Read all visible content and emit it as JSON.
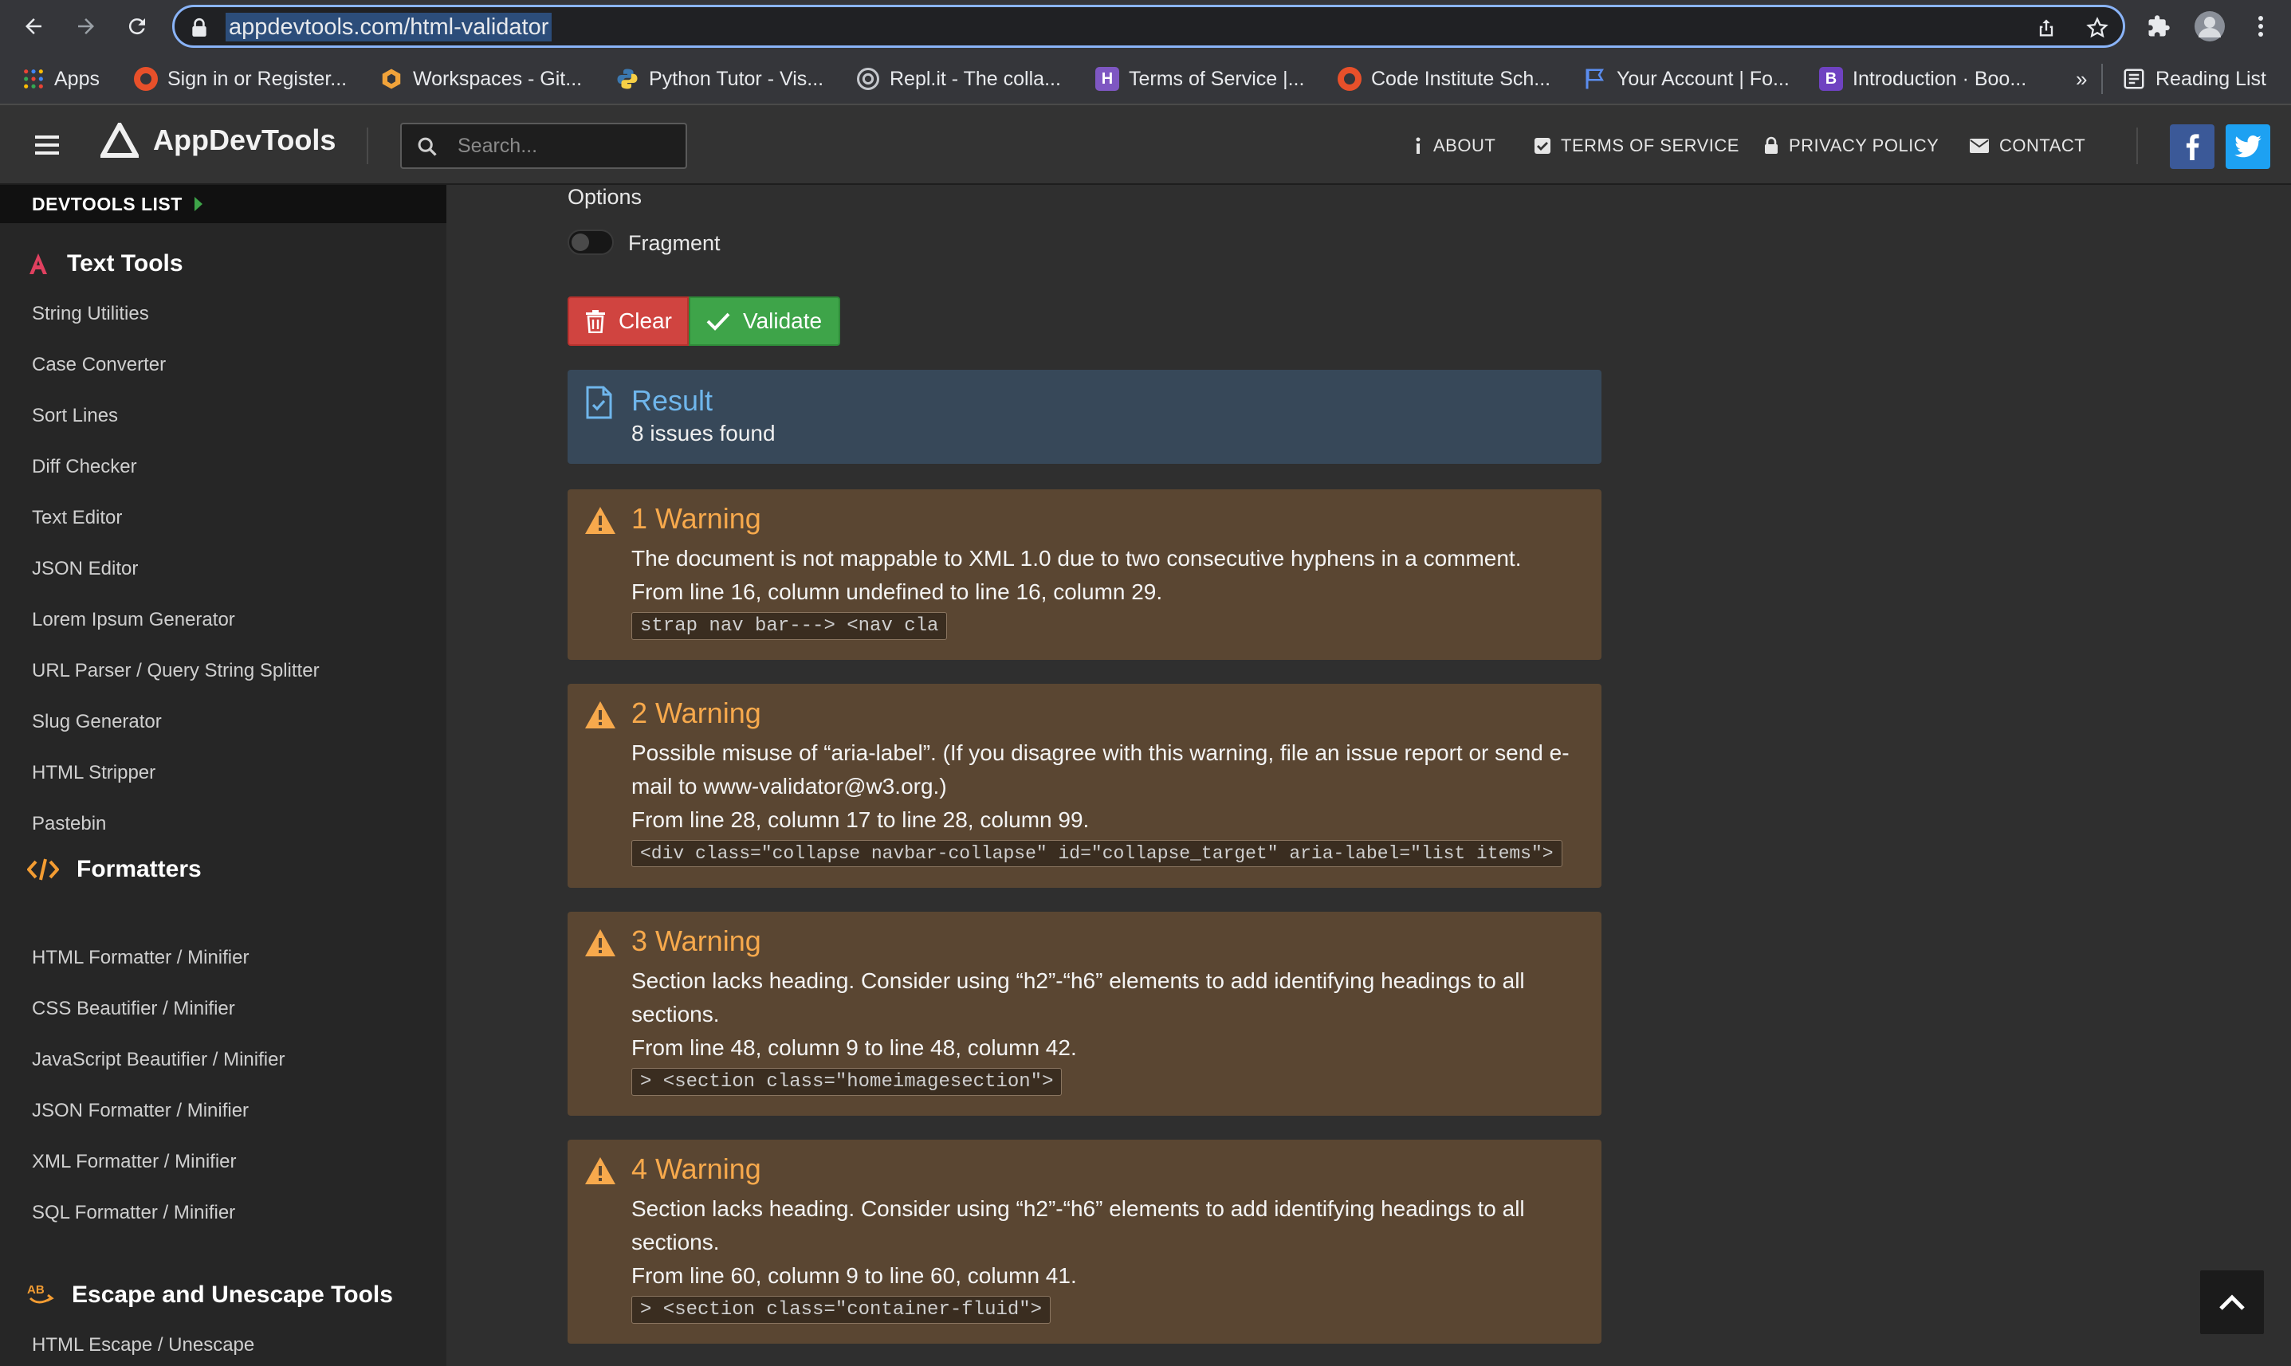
{
  "browser": {
    "url": "appdevtools.com/html-validator",
    "bookmarks": [
      {
        "label": "Apps",
        "icon": "apps-grid-icon",
        "color": "#ea4335"
      },
      {
        "label": "Sign in or Register...",
        "icon": "udemy-icon",
        "color": "#e8502a"
      },
      {
        "label": "Workspaces - Git...",
        "icon": "gitpod-icon",
        "color": "#f1a33a"
      },
      {
        "label": "Python Tutor - Vis...",
        "icon": "python-icon",
        "color": "#3b78b0"
      },
      {
        "label": "Repl.it - The colla...",
        "icon": "replit-icon",
        "color": "#9aa0a6"
      },
      {
        "label": "Terms of Service |...",
        "icon": "heroku-icon",
        "color": "#7e57c2"
      },
      {
        "label": "Code Institute Sch...",
        "icon": "codeinstitute-icon",
        "color": "#e8502a"
      },
      {
        "label": "Your Account | Fo...",
        "icon": "flag-icon",
        "color": "#5b8def"
      },
      {
        "label": "Introduction · Boo...",
        "icon": "bootstrap-icon",
        "color": "#6f42c1"
      }
    ],
    "more": "»",
    "reading_list": "Reading List"
  },
  "header": {
    "brand": "AppDevTools",
    "search_placeholder": "Search...",
    "nav": [
      {
        "label": "ABOUT",
        "icon": "info-icon"
      },
      {
        "label": "TERMS OF SERVICE",
        "icon": "checkbox-icon"
      },
      {
        "label": "PRIVACY POLICY",
        "icon": "lock-icon"
      },
      {
        "label": "CONTACT",
        "icon": "envelope-icon"
      }
    ],
    "facebook_color": "#3b5998",
    "twitter_color": "#1da1f2"
  },
  "sidebar": {
    "heading": "DEVTOOLS LIST",
    "sections": [
      {
        "title": "Text Tools",
        "icon": "text-a-icon",
        "icon_color": "#e0405f",
        "items": [
          "String Utilities",
          "Case Converter",
          "Sort Lines",
          "Diff Checker",
          "Text Editor",
          "JSON Editor",
          "Lorem Ipsum Generator",
          "URL Parser / Query String Splitter",
          "Slug Generator",
          "HTML Stripper",
          "Pastebin"
        ]
      },
      {
        "title": "Formatters",
        "icon": "code-icon",
        "icon_color": "#f39c32",
        "items": [
          "HTML Formatter / Minifier",
          "CSS Beautifier / Minifier",
          "JavaScript Beautifier / Minifier",
          "JSON Formatter / Minifier",
          "XML Formatter / Minifier",
          "SQL Formatter / Minifier"
        ]
      },
      {
        "title": "Escape and Unescape Tools",
        "icon": "ab-icon",
        "icon_color": "#f39c32",
        "items": [
          "HTML Escape / Unescape"
        ]
      }
    ]
  },
  "main": {
    "options_label": "Options",
    "fragment_label": "Fragment",
    "fragment_on": false,
    "clear_label": "Clear",
    "validate_label": "Validate",
    "result_title": "Result",
    "result_summary": "8 issues found",
    "warnings": [
      {
        "title": "1 Warning",
        "message": "The document is not mappable to XML 1.0 due to two consecutive hyphens in a comment.",
        "location": "From line 16, column undefined to line 16, column 29.",
        "code": "strap nav bar---> <nav cla"
      },
      {
        "title": "2 Warning",
        "message": "Possible misuse of “aria-label”. (If you disagree with this warning, file an issue report or send e-mail to www-validator@w3.org.)",
        "location": "From line 28, column 17 to line 28, column 99.",
        "code": "<div class=\"collapse navbar-collapse\" id=\"collapse_target\" aria-label=\"list items\">"
      },
      {
        "title": "3 Warning",
        "message": "Section lacks heading. Consider using “h2”-“h6” elements to add identifying headings to all sections.",
        "location": "From line 48, column 9 to line 48, column 42.",
        "code": "> <section class=\"homeimagesection\">"
      },
      {
        "title": "4 Warning",
        "message": "Section lacks heading. Consider using “h2”-“h6” elements to add identifying headings to all sections.",
        "location": "From line 60, column 9 to line 60, column 41.",
        "code": "> <section class=\"container-fluid\">"
      }
    ]
  }
}
